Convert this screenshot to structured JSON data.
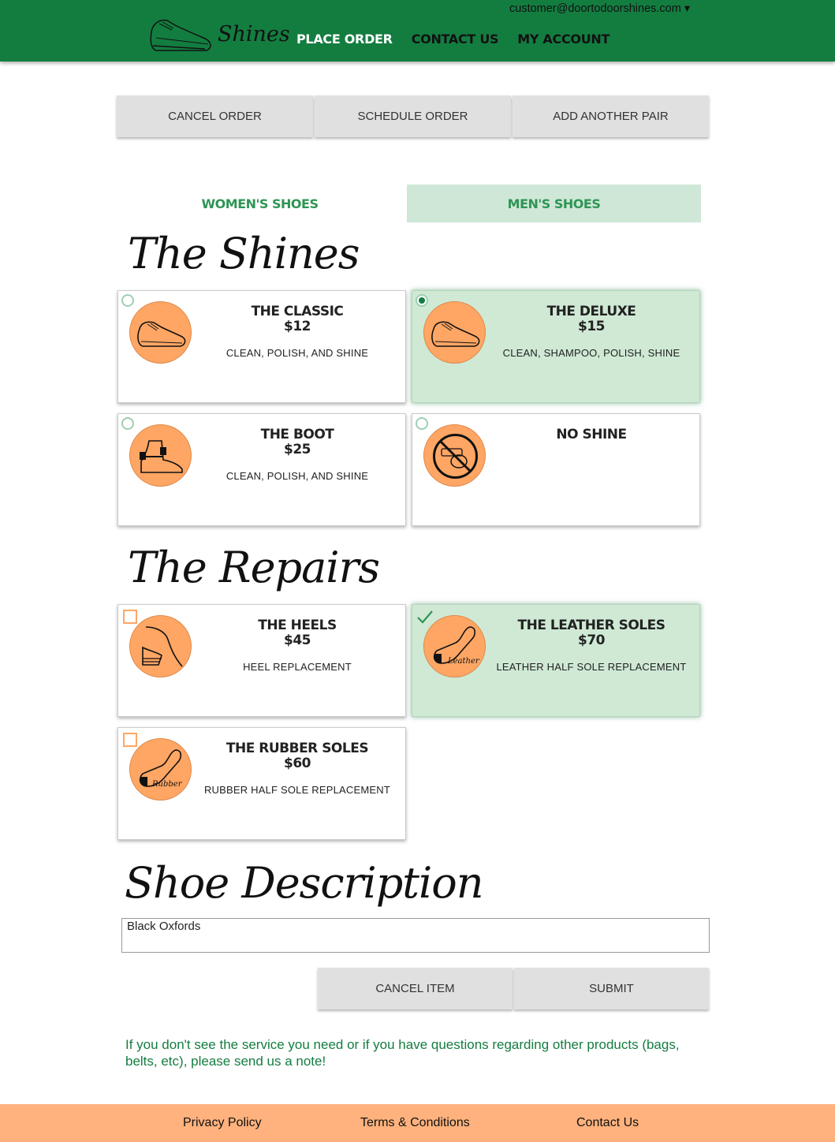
{
  "header": {
    "logo_text": "Shines",
    "account_email": "customer@doortodoorshines.com ▾",
    "nav": [
      {
        "label": "PLACE ORDER",
        "active": true
      },
      {
        "label": "CONTACT US",
        "active": false
      },
      {
        "label": "MY ACCOUNT",
        "active": false
      }
    ]
  },
  "actions": {
    "cancel_order": "CANCEL ORDER",
    "schedule_order": "SCHEDULE ORDER",
    "add_pair": "ADD ANOTHER PAIR"
  },
  "tabs": {
    "womens": "WOMEN'S SHOES",
    "mens": "MEN'S SHOES",
    "selected": "mens"
  },
  "shines": {
    "heading": "The Shines",
    "items": [
      {
        "title": "THE CLASSIC",
        "price": "$12",
        "desc": "CLEAN, POLISH, AND SHINE",
        "icon": "dress-shoe-icon",
        "selected": false
      },
      {
        "title": "THE DELUXE",
        "price": "$15",
        "desc": "CLEAN, SHAMPOO, POLISH, SHINE",
        "icon": "dress-shoe-icon",
        "selected": true
      },
      {
        "title": "THE BOOT",
        "price": "$25",
        "desc": "CLEAN, POLISH, AND SHINE",
        "icon": "boot-icon",
        "selected": false
      },
      {
        "title": "NO SHINE",
        "price": "",
        "desc": "",
        "icon": "no-shine-icon",
        "selected": false
      }
    ]
  },
  "repairs": {
    "heading": "The Repairs",
    "items": [
      {
        "title": "THE HEELS",
        "price": "$45",
        "desc": "HEEL REPLACEMENT",
        "icon": "heel-icon",
        "checked": false
      },
      {
        "title": "THE LEATHER SOLES",
        "price": "$70",
        "desc": "LEATHER HALF SOLE REPLACEMENT",
        "icon": "leather-sole-icon",
        "icon_label": "Leather",
        "checked": true
      },
      {
        "title": "THE RUBBER SOLES",
        "price": "$60",
        "desc": "RUBBER HALF SOLE REPLACEMENT",
        "icon": "rubber-sole-icon",
        "icon_label": "Rubber",
        "checked": false
      }
    ]
  },
  "description": {
    "heading": "Shoe Description",
    "value": "Black Oxfords"
  },
  "form_actions": {
    "cancel_item": "CANCEL ITEM",
    "submit": "SUBMIT"
  },
  "note": "If you don't see the service you need or if you have questions regarding other products (bags, belts, etc), please send us a note!",
  "footer": {
    "privacy": "Privacy Policy",
    "terms": "Terms & Conditions",
    "contact": "Contact Us"
  },
  "colors": {
    "header_green": "#137d40",
    "selected_bg": "#cfe9d5",
    "icon_orange": "#ffa664",
    "footer_orange": "#ffb27d"
  }
}
